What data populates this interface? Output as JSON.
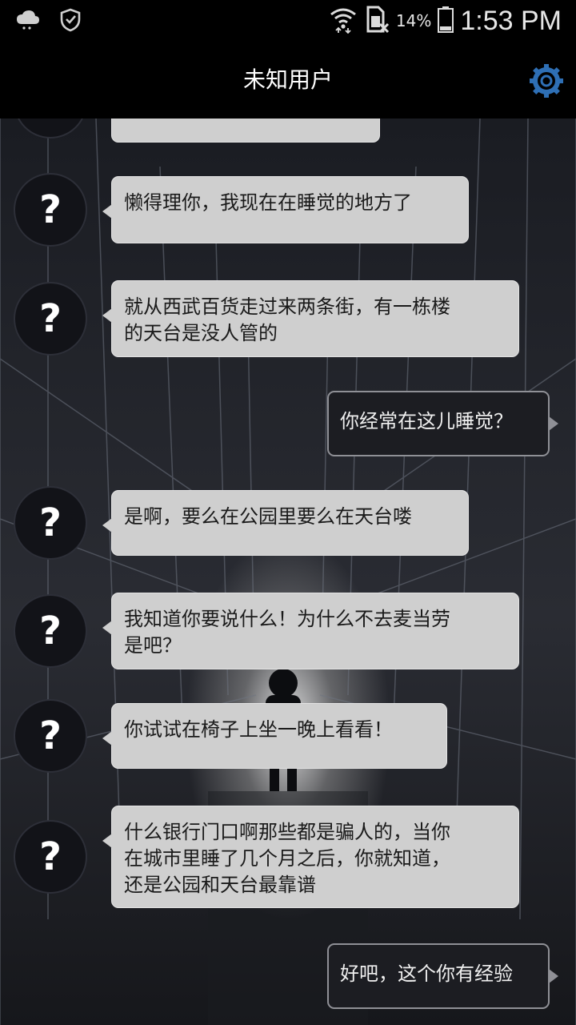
{
  "status_bar": {
    "icons_left": [
      "weather-cloud-icon",
      "shield-check-icon"
    ],
    "icons_right": [
      "wifi-icon",
      "no-sim-icon",
      "battery-icon"
    ],
    "battery_percent": "14%",
    "time": "1:53 PM"
  },
  "header": {
    "title": "未知用户",
    "settings_icon": "gear-icon"
  },
  "colors": {
    "incoming_bubble": "#cfcfcf",
    "outgoing_bubble": "#1c1d22",
    "outgoing_border": "#8f9096",
    "settings_icon": "#2e6fb5"
  },
  "messages": [
    {
      "from": "unknown",
      "avatar": "?",
      "text": ""
    },
    {
      "from": "unknown",
      "avatar": "?",
      "text": "懒得理你，我现在在睡觉的地方了"
    },
    {
      "from": "unknown",
      "avatar": "?",
      "text": "就从西武百货走过来两条街，有一栋楼\n的天台是没人管的"
    },
    {
      "from": "me",
      "text": "你经常在这儿睡觉？"
    },
    {
      "from": "unknown",
      "avatar": "?",
      "text": "是啊，要么在公园里要么在天台喽"
    },
    {
      "from": "unknown",
      "avatar": "?",
      "text": "我知道你要说什么！为什么不去麦当劳\n是吧？"
    },
    {
      "from": "unknown",
      "avatar": "?",
      "text": "你试试在椅子上坐一晚上看看！"
    },
    {
      "from": "unknown",
      "avatar": "?",
      "text": "什么银行门口啊那些都是骗人的，当你\n在城市里睡了几个月之后，你就知道，\n还是公园和天台最靠谱"
    },
    {
      "from": "me",
      "text": "好吧，这个你有经验"
    }
  ]
}
